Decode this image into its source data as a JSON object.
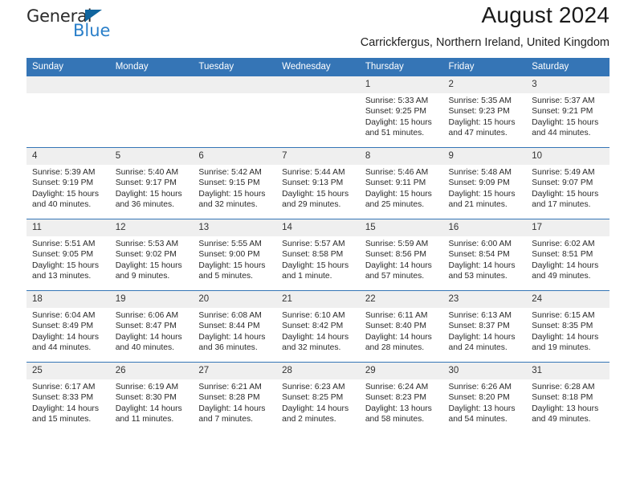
{
  "brand": {
    "name_part1": "General",
    "name_part2": "Blue",
    "triangle_icon": "triangle-icon",
    "color_dark": "#2b2b2b",
    "color_blue": "#2a7fc9"
  },
  "header": {
    "title": "August 2024",
    "subtitle": "Carrickfergus, Northern Ireland, United Kingdom",
    "accent_color": "#3575b6"
  },
  "weekday_headers": [
    "Sunday",
    "Monday",
    "Tuesday",
    "Wednesday",
    "Thursday",
    "Friday",
    "Saturday"
  ],
  "weeks": [
    [
      {
        "day": "",
        "sunrise": "",
        "sunset": "",
        "daylight": "",
        "empty": true
      },
      {
        "day": "",
        "sunrise": "",
        "sunset": "",
        "daylight": "",
        "empty": true
      },
      {
        "day": "",
        "sunrise": "",
        "sunset": "",
        "daylight": "",
        "empty": true
      },
      {
        "day": "",
        "sunrise": "",
        "sunset": "",
        "daylight": "",
        "empty": true
      },
      {
        "day": "1",
        "sunrise": "Sunrise: 5:33 AM",
        "sunset": "Sunset: 9:25 PM",
        "daylight": "Daylight: 15 hours and 51 minutes."
      },
      {
        "day": "2",
        "sunrise": "Sunrise: 5:35 AM",
        "sunset": "Sunset: 9:23 PM",
        "daylight": "Daylight: 15 hours and 47 minutes."
      },
      {
        "day": "3",
        "sunrise": "Sunrise: 5:37 AM",
        "sunset": "Sunset: 9:21 PM",
        "daylight": "Daylight: 15 hours and 44 minutes."
      }
    ],
    [
      {
        "day": "4",
        "sunrise": "Sunrise: 5:39 AM",
        "sunset": "Sunset: 9:19 PM",
        "daylight": "Daylight: 15 hours and 40 minutes."
      },
      {
        "day": "5",
        "sunrise": "Sunrise: 5:40 AM",
        "sunset": "Sunset: 9:17 PM",
        "daylight": "Daylight: 15 hours and 36 minutes."
      },
      {
        "day": "6",
        "sunrise": "Sunrise: 5:42 AM",
        "sunset": "Sunset: 9:15 PM",
        "daylight": "Daylight: 15 hours and 32 minutes."
      },
      {
        "day": "7",
        "sunrise": "Sunrise: 5:44 AM",
        "sunset": "Sunset: 9:13 PM",
        "daylight": "Daylight: 15 hours and 29 minutes."
      },
      {
        "day": "8",
        "sunrise": "Sunrise: 5:46 AM",
        "sunset": "Sunset: 9:11 PM",
        "daylight": "Daylight: 15 hours and 25 minutes."
      },
      {
        "day": "9",
        "sunrise": "Sunrise: 5:48 AM",
        "sunset": "Sunset: 9:09 PM",
        "daylight": "Daylight: 15 hours and 21 minutes."
      },
      {
        "day": "10",
        "sunrise": "Sunrise: 5:49 AM",
        "sunset": "Sunset: 9:07 PM",
        "daylight": "Daylight: 15 hours and 17 minutes."
      }
    ],
    [
      {
        "day": "11",
        "sunrise": "Sunrise: 5:51 AM",
        "sunset": "Sunset: 9:05 PM",
        "daylight": "Daylight: 15 hours and 13 minutes."
      },
      {
        "day": "12",
        "sunrise": "Sunrise: 5:53 AM",
        "sunset": "Sunset: 9:02 PM",
        "daylight": "Daylight: 15 hours and 9 minutes."
      },
      {
        "day": "13",
        "sunrise": "Sunrise: 5:55 AM",
        "sunset": "Sunset: 9:00 PM",
        "daylight": "Daylight: 15 hours and 5 minutes."
      },
      {
        "day": "14",
        "sunrise": "Sunrise: 5:57 AM",
        "sunset": "Sunset: 8:58 PM",
        "daylight": "Daylight: 15 hours and 1 minute."
      },
      {
        "day": "15",
        "sunrise": "Sunrise: 5:59 AM",
        "sunset": "Sunset: 8:56 PM",
        "daylight": "Daylight: 14 hours and 57 minutes."
      },
      {
        "day": "16",
        "sunrise": "Sunrise: 6:00 AM",
        "sunset": "Sunset: 8:54 PM",
        "daylight": "Daylight: 14 hours and 53 minutes."
      },
      {
        "day": "17",
        "sunrise": "Sunrise: 6:02 AM",
        "sunset": "Sunset: 8:51 PM",
        "daylight": "Daylight: 14 hours and 49 minutes."
      }
    ],
    [
      {
        "day": "18",
        "sunrise": "Sunrise: 6:04 AM",
        "sunset": "Sunset: 8:49 PM",
        "daylight": "Daylight: 14 hours and 44 minutes."
      },
      {
        "day": "19",
        "sunrise": "Sunrise: 6:06 AM",
        "sunset": "Sunset: 8:47 PM",
        "daylight": "Daylight: 14 hours and 40 minutes."
      },
      {
        "day": "20",
        "sunrise": "Sunrise: 6:08 AM",
        "sunset": "Sunset: 8:44 PM",
        "daylight": "Daylight: 14 hours and 36 minutes."
      },
      {
        "day": "21",
        "sunrise": "Sunrise: 6:10 AM",
        "sunset": "Sunset: 8:42 PM",
        "daylight": "Daylight: 14 hours and 32 minutes."
      },
      {
        "day": "22",
        "sunrise": "Sunrise: 6:11 AM",
        "sunset": "Sunset: 8:40 PM",
        "daylight": "Daylight: 14 hours and 28 minutes."
      },
      {
        "day": "23",
        "sunrise": "Sunrise: 6:13 AM",
        "sunset": "Sunset: 8:37 PM",
        "daylight": "Daylight: 14 hours and 24 minutes."
      },
      {
        "day": "24",
        "sunrise": "Sunrise: 6:15 AM",
        "sunset": "Sunset: 8:35 PM",
        "daylight": "Daylight: 14 hours and 19 minutes."
      }
    ],
    [
      {
        "day": "25",
        "sunrise": "Sunrise: 6:17 AM",
        "sunset": "Sunset: 8:33 PM",
        "daylight": "Daylight: 14 hours and 15 minutes."
      },
      {
        "day": "26",
        "sunrise": "Sunrise: 6:19 AM",
        "sunset": "Sunset: 8:30 PM",
        "daylight": "Daylight: 14 hours and 11 minutes."
      },
      {
        "day": "27",
        "sunrise": "Sunrise: 6:21 AM",
        "sunset": "Sunset: 8:28 PM",
        "daylight": "Daylight: 14 hours and 7 minutes."
      },
      {
        "day": "28",
        "sunrise": "Sunrise: 6:23 AM",
        "sunset": "Sunset: 8:25 PM",
        "daylight": "Daylight: 14 hours and 2 minutes."
      },
      {
        "day": "29",
        "sunrise": "Sunrise: 6:24 AM",
        "sunset": "Sunset: 8:23 PM",
        "daylight": "Daylight: 13 hours and 58 minutes."
      },
      {
        "day": "30",
        "sunrise": "Sunrise: 6:26 AM",
        "sunset": "Sunset: 8:20 PM",
        "daylight": "Daylight: 13 hours and 54 minutes."
      },
      {
        "day": "31",
        "sunrise": "Sunrise: 6:28 AM",
        "sunset": "Sunset: 8:18 PM",
        "daylight": "Daylight: 13 hours and 49 minutes."
      }
    ]
  ]
}
